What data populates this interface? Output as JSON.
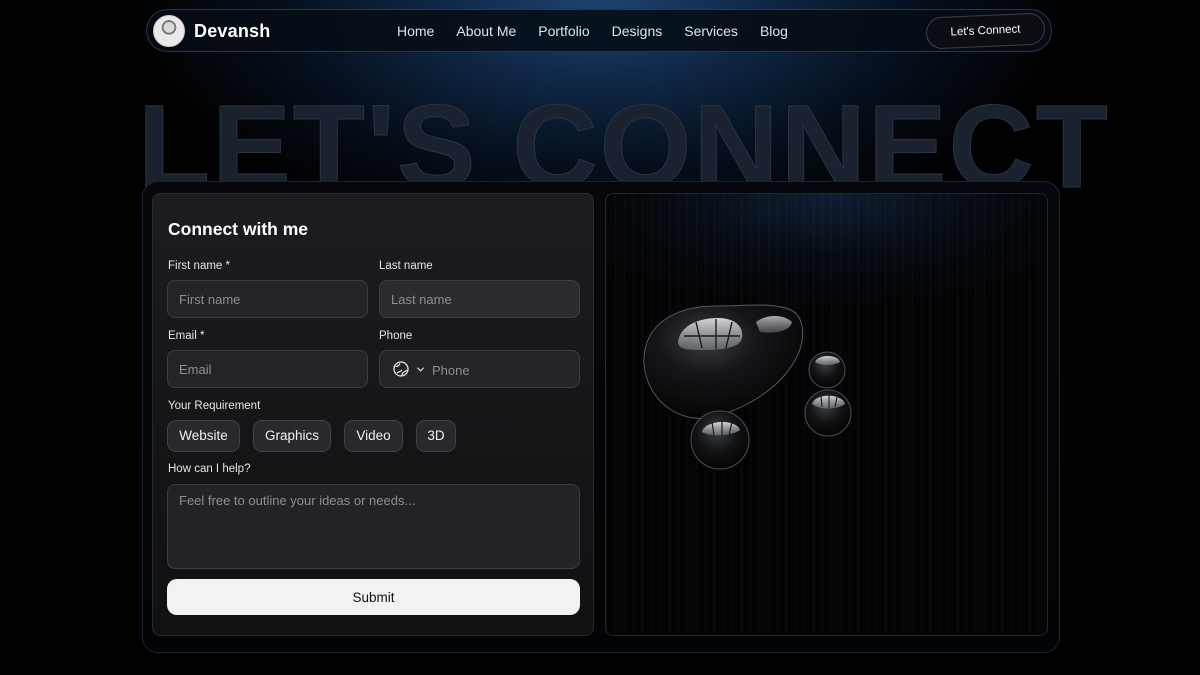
{
  "nav": {
    "brand": "Devansh",
    "links": [
      "Home",
      "About Me",
      "Portfolio",
      "Designs",
      "Services",
      "Blog"
    ],
    "cta": "Let's Connect"
  },
  "hero": {
    "heading": "LET'S CONNECT"
  },
  "form": {
    "title": "Connect with me",
    "first_name": {
      "label": "First name *",
      "placeholder": "First name"
    },
    "last_name": {
      "label": "Last name",
      "placeholder": "Last name"
    },
    "email": {
      "label": "Email *",
      "placeholder": "Email"
    },
    "phone": {
      "label": "Phone",
      "placeholder": "Phone"
    },
    "requirement": {
      "label": "Your Requirement",
      "options": [
        "Website",
        "Graphics",
        "Video",
        "3D"
      ]
    },
    "help": {
      "label": "How can I help?",
      "placeholder": "Feel free to outline your ideas or needs..."
    },
    "submit": "Submit"
  },
  "colors": {
    "background": "#000000",
    "nav_glow": "#1d4270",
    "panel": "#1b1d21",
    "submit_bg": "#f2f2f2"
  },
  "icons": [
    "avatar",
    "globe-icon",
    "chevron-down-icon"
  ]
}
